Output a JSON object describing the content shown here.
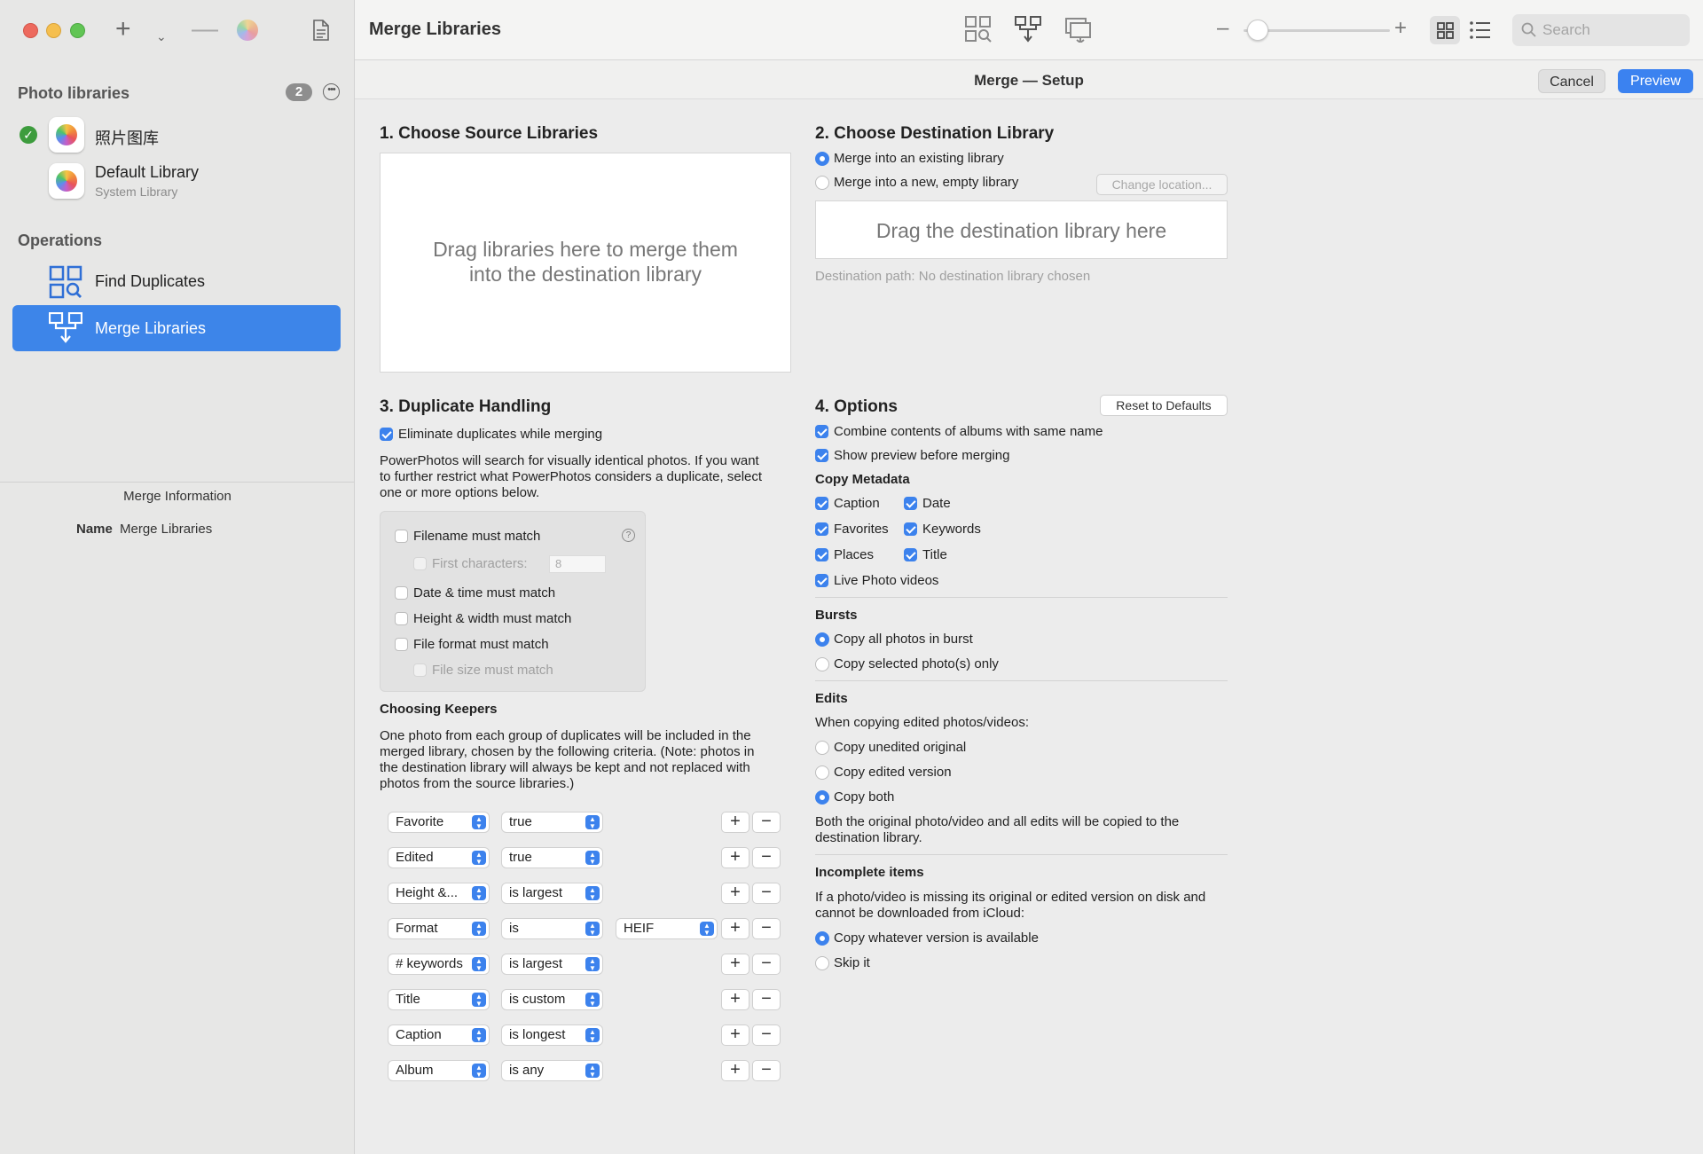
{
  "sidebar": {
    "photo_libraries_title": "Photo libraries",
    "badge_count": "2",
    "libraries": [
      {
        "name": "照片图库",
        "subtitle": "",
        "icon": "photos-app-icon",
        "status": "check"
      },
      {
        "name": "Default Library",
        "subtitle": "System Library",
        "icon": "photos-app-icon"
      }
    ],
    "operations_title": "Operations",
    "operations": [
      {
        "label": "Find Duplicates",
        "icon": "find-duplicates-icon",
        "selected": false
      },
      {
        "label": "Merge Libraries",
        "icon": "merge-libraries-icon",
        "selected": true
      }
    ],
    "info_title": "Merge Information",
    "info_name_label": "Name",
    "info_name_value": "Merge Libraries"
  },
  "toolbar": {
    "title": "Merge Libraries",
    "search_placeholder": "Search"
  },
  "setup": {
    "title": "Merge — Setup",
    "cancel_label": "Cancel",
    "preview_label": "Preview"
  },
  "section1": {
    "title": "1. Choose Source Libraries",
    "drop_line1": "Drag libraries here to merge them",
    "drop_line2": "into the destination library"
  },
  "section2": {
    "title": "2. Choose Destination Library",
    "opt_existing": "Merge into an existing library",
    "opt_new": "Merge into a new, empty library",
    "change_location": "Change location...",
    "drop_text": "Drag the destination library here",
    "dest_path": "Destination path: No destination library chosen"
  },
  "section3": {
    "title": "3. Duplicate Handling",
    "eliminate": "Eliminate duplicates while merging",
    "desc_1": "PowerPhotos will search for visually identical photos. If you want",
    "desc_2": "to further restrict what PowerPhotos considers a duplicate, select",
    "desc_3": "one or more options below.",
    "filename": "Filename must match",
    "first_chars": "First characters:",
    "first_chars_value": "8",
    "datetime": "Date & time must match",
    "height_width": "Height & width must match",
    "file_format": "File format must match",
    "file_size": "File size must match",
    "keepers_title": "Choosing Keepers",
    "keepers_1": "One photo from each group of duplicates will be included in the",
    "keepers_2": "merged library, chosen by the following criteria. (Note: photos in",
    "keepers_3": "the destination library will always be kept and not replaced with",
    "keepers_4": "photos from the source libraries.)",
    "rules": [
      {
        "field": "Favorite",
        "op": "true",
        "value": ""
      },
      {
        "field": "Edited",
        "op": "true",
        "value": ""
      },
      {
        "field": "Height &...",
        "op": "is largest",
        "value": ""
      },
      {
        "field": "Format",
        "op": "is",
        "value": "HEIF"
      },
      {
        "field": "# keywords",
        "op": "is largest",
        "value": ""
      },
      {
        "field": "Title",
        "op": "is custom",
        "value": ""
      },
      {
        "field": "Caption",
        "op": "is longest",
        "value": ""
      },
      {
        "field": "Album",
        "op": "is any",
        "value": ""
      }
    ]
  },
  "section4": {
    "title": "4. Options",
    "reset": "Reset to Defaults",
    "combine_albums": "Combine contents of albums with same name",
    "show_preview": "Show preview before merging",
    "copy_metadata_title": "Copy Metadata",
    "caption": "Caption",
    "date": "Date",
    "favorites": "Favorites",
    "keywords": "Keywords",
    "places": "Places",
    "title_meta": "Title",
    "live_photo": "Live Photo videos",
    "bursts_title": "Bursts",
    "burst_all": "Copy all photos in burst",
    "burst_selected": "Copy selected photo(s) only",
    "edits_title": "Edits",
    "edits_desc": "When copying edited photos/videos:",
    "edit_unedited": "Copy unedited original",
    "edit_edited": "Copy edited version",
    "edit_both": "Copy both",
    "edits_note_1": "Both the original photo/video and all edits will be copied to the",
    "edits_note_2": "destination library.",
    "incomplete_title": "Incomplete items",
    "incomplete_1": "If a photo/video is missing its original or edited version on disk and",
    "incomplete_2": "cannot be downloaded from iCloud:",
    "inc_whatever": "Copy whatever version is available",
    "inc_skip": "Skip it"
  },
  "colors": {
    "accent": "#3c82ed",
    "selected_row": "#3d85e9",
    "check_green": "#3d9c3d"
  }
}
